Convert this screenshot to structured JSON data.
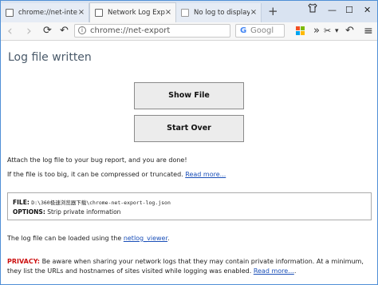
{
  "tabs": [
    {
      "title": "chrome://net-inte"
    },
    {
      "title": "Network Log Exp"
    },
    {
      "title": "No log to display"
    }
  ],
  "tab_close_glyph": "×",
  "new_tab_glyph": "+",
  "window_controls": {
    "shirt": "🝖",
    "minimize": "—",
    "maximize": "☐",
    "close": "✕"
  },
  "toolbar": {
    "back_icon": "‹",
    "forward_icon": "›",
    "reload_icon": "⟳",
    "undo_icon": "↶",
    "info_glyph": "i",
    "url": "chrome://net-export",
    "search_placeholder": "Googl",
    "search_g": "G",
    "more_tools_glyph": "»",
    "scissors_glyph": "✂",
    "dropdown_glyph": "▾",
    "menu_glyph": "≡"
  },
  "page": {
    "title": "Log file written",
    "show_file_button": "Show File",
    "start_over_button": "Start Over",
    "attach_text": "Attach the log file to your bug report, and you are done!",
    "too_big_text": "If the file is too big, it can be compressed or truncated.",
    "read_more_link": "Read more...",
    "file_label": "FILE:",
    "file_path": "D:\\360极速浏览器下载\\chrome-net-export-log.json",
    "options_label": "OPTIONS:",
    "options_value": "Strip private information",
    "loaded_text": "The log file can be loaded using the",
    "netlog_viewer_link": "netlog_viewer",
    "loaded_suffix": ".",
    "privacy_label": "PRIVACY:",
    "privacy_text": "Be aware when sharing your network logs that they may contain private information. At a minimum, they list the URLs and hostnames of sites visited while logging was enabled.",
    "privacy_read_more": "Read more...",
    "privacy_suffix": "."
  },
  "colors": {
    "link": "#1a4fb8",
    "privacy_label": "#cc1010",
    "title": "#4a5a6a",
    "tabstrip": "#d9e3f1",
    "window_border": "#4f8fd6"
  }
}
